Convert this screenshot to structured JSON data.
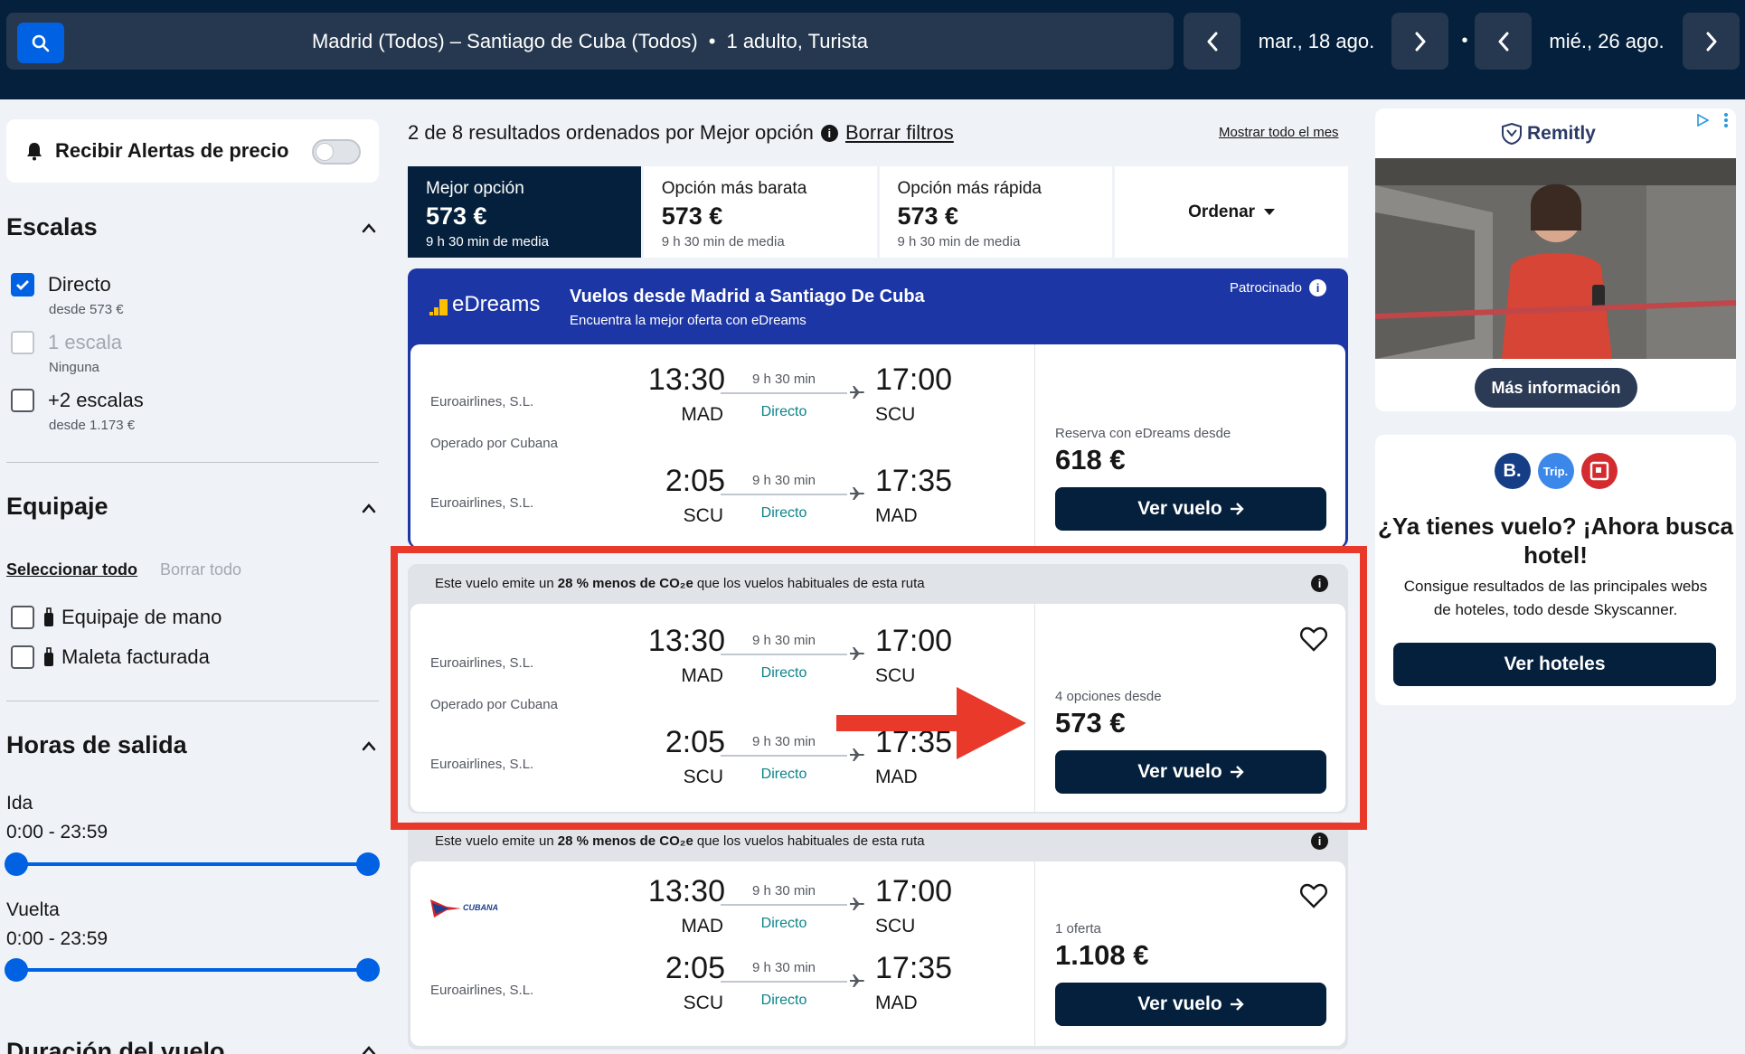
{
  "header": {
    "route": "Madrid (Todos) – Santiago de Cuba (Todos)",
    "separator": "•",
    "passengers": "1 adulto, Turista",
    "depart_date": "mar., 18 ago.",
    "return_date": "mié., 26 ago.",
    "date_dot": "•"
  },
  "sidebar": {
    "alerts_label": "Recibir Alertas de precio",
    "stops": {
      "title": "Escalas",
      "options": [
        {
          "label": "Directo",
          "sub": "desde 573 €",
          "checked": true
        },
        {
          "label": "1 escala",
          "sub": "Ninguna",
          "disabled": true
        },
        {
          "label": "+2 escalas",
          "sub": "desde 1.173 €"
        }
      ]
    },
    "baggage": {
      "title": "Equipaje",
      "select_all": "Seleccionar todo",
      "clear_all": "Borrar todo",
      "options": [
        "Equipaje de mano",
        "Maleta facturada"
      ]
    },
    "departure_times": {
      "title": "Horas de salida",
      "outbound_label": "Ida",
      "outbound_range": "0:00 - 23:59",
      "return_label": "Vuelta",
      "return_range": "0:00 - 23:59"
    },
    "duration_title": "Duración del vuelo"
  },
  "results": {
    "summary": "2 de 8 resultados ordenados por Mejor opción",
    "clear_filters": "Borrar filtros",
    "show_month": "Mostrar todo el mes"
  },
  "tabs": [
    {
      "label": "Mejor opción",
      "price": "573 €",
      "sub": "9 h 30 min de media"
    },
    {
      "label": "Opción más barata",
      "price": "573 €",
      "sub": "9 h 30 min de media"
    },
    {
      "label": "Opción más rápida",
      "price": "573 €",
      "sub": "9 h 30 min de media"
    }
  ],
  "sort_label": "Ordenar",
  "sponsored": {
    "brand": "eDreams",
    "title": "Vuelos desde Madrid a Santiago De Cuba",
    "subtitle": "Encuentra la mejor oferta con eDreams",
    "tag": "Patrocinado",
    "price_label": "Reserva con eDreams desde",
    "price": "618 €",
    "button": "Ver vuelo"
  },
  "flights": [
    {
      "eco_prefix": "Este vuelo emite un",
      "eco_bold": "28 % menos de CO₂e",
      "eco_suffix": "que los vuelos habituales de esta ruta",
      "price_label": "4 opciones desde",
      "price": "573 €",
      "button": "Ver vuelo"
    },
    {
      "eco_prefix": "Este vuelo emite un",
      "eco_bold": "28 % menos de CO₂e",
      "eco_suffix": "que los vuelos habituales de esta ruta",
      "airline_logo_text": "CUBANA",
      "price_label": "1 oferta",
      "price": "1.108 €",
      "button": "Ver vuelo"
    }
  ],
  "itinerary": {
    "airline": "Euroairlines, S.L.",
    "operated_by": "Operado por Cubana",
    "out": {
      "dep_time": "13:30",
      "dep_code": "MAD",
      "duration": "9 h 30 min",
      "stops": "Directo",
      "arr_time": "17:00",
      "arr_code": "SCU"
    },
    "ret": {
      "dep_time": "2:05",
      "dep_code": "SCU",
      "duration": "9 h 30 min",
      "stops": "Directo",
      "arr_time": "17:35",
      "arr_code": "MAD"
    }
  },
  "ad": {
    "brand": "Remitly",
    "button": "Más información"
  },
  "hotel": {
    "title": "¿Ya tienes vuelo? ¡Ahora busca hotel!",
    "text": "Consigue resultados de las principales webs de hoteles, todo desde Skyscanner.",
    "button": "Ver hoteles",
    "logos": [
      "B.",
      "Trip."
    ]
  },
  "colors": {
    "navy": "#05203c",
    "blue": "#0062e3",
    "teal": "#0c838a",
    "highlight": "#e8392a"
  }
}
